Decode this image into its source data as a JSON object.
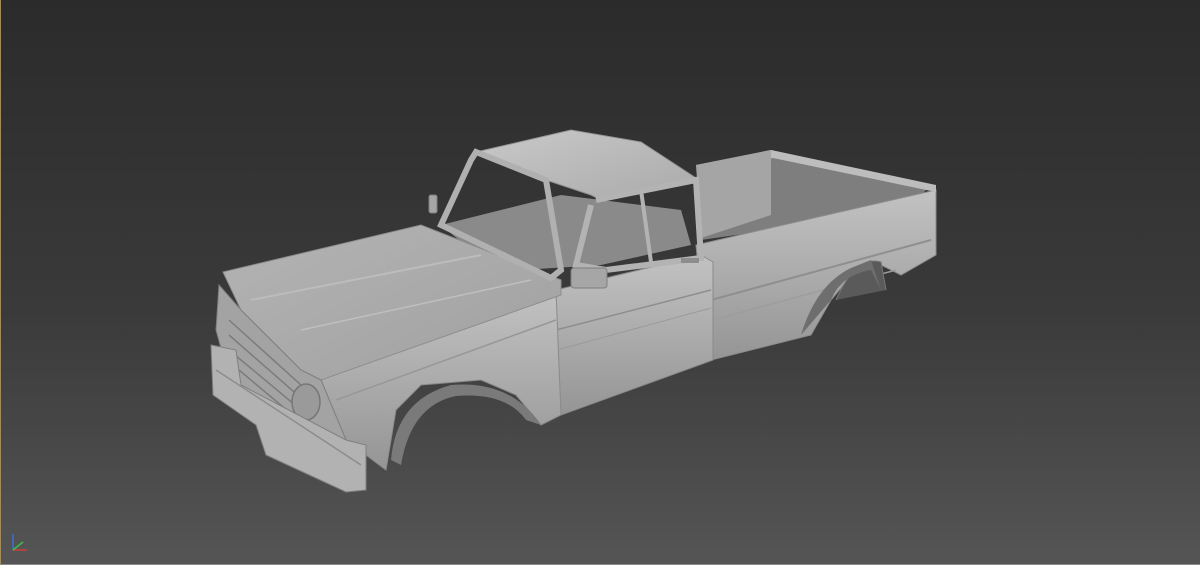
{
  "viewport": {
    "background_top": "#2b2b2b",
    "background_bottom": "#555555",
    "border_accent": "#b8892f"
  },
  "model": {
    "type": "pickup-truck-body",
    "material_color": "#a9a9a9",
    "shadow_color": "#6e6e6e",
    "highlight_color": "#c6c6c6"
  },
  "axis_gizmo": {
    "x_color": "#d23c3c",
    "y_color": "#3cbf4a",
    "z_color": "#3c6fd2"
  }
}
